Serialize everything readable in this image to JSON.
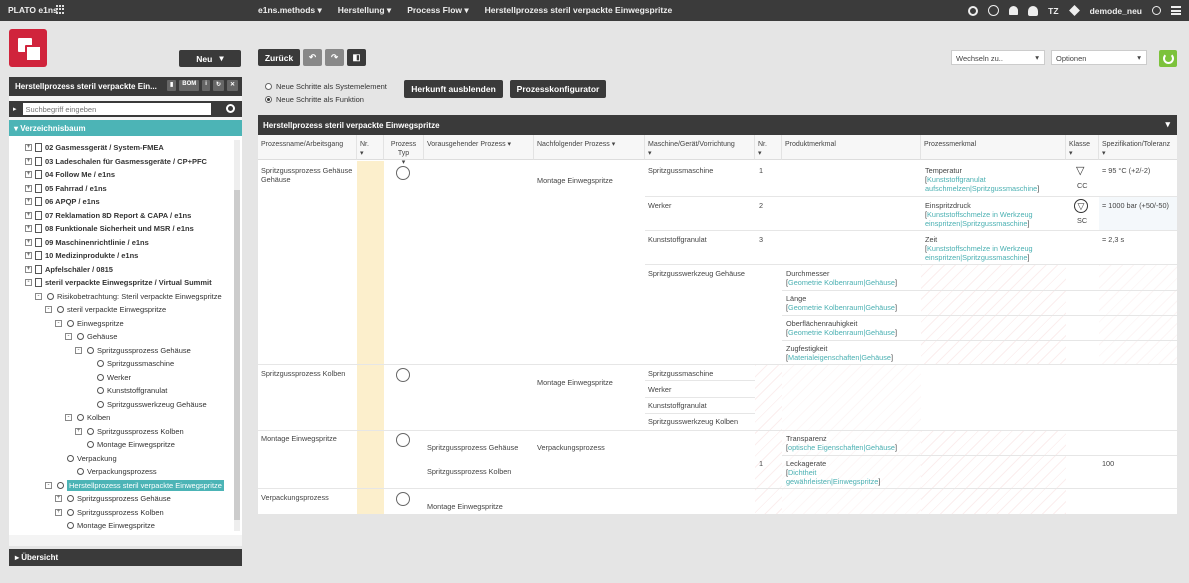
{
  "app": {
    "title": "PLATO e1ns"
  },
  "topnav": {
    "methods": "e1ns.methods",
    "herstellung": "Herstellung",
    "processflow": "Process Flow",
    "current": "Herstellprozess steril verpackte Einwegspritze",
    "user": "TZ",
    "workspace": "demode_neu"
  },
  "toolbar": {
    "neu": "Neu",
    "zurueck": "Zurück",
    "herkunft": "Herkunft ausblenden",
    "prozesskonfigurator": "Prozesskonfigurator",
    "wechseln": "Wechseln zu..",
    "optionen": "Optionen"
  },
  "radios": {
    "opt1": "Neue Schritte als Systemelement",
    "opt2": "Neue Schritte als Funktion"
  },
  "leftpanel": {
    "title": "Herstellprozess steril verpackte Ein...",
    "bom": "BOM",
    "search_placeholder": "Suchbegriff eingeben",
    "tree_title": "Verzeichnisbaum",
    "overview": "Übersicht"
  },
  "tree": [
    {
      "label": "02 Gasmessgerät / System-FMEA"
    },
    {
      "label": "03 Ladeschalen für Gasmessgeräte / CP+PFC"
    },
    {
      "label": "04 Follow Me / e1ns"
    },
    {
      "label": "05 Fahrrad / e1ns"
    },
    {
      "label": "06 APQP / e1ns"
    },
    {
      "label": "07 Reklamation 8D Report & CAPA / e1ns"
    },
    {
      "label": "08 Funktionale Sicherheit und MSR / e1ns"
    },
    {
      "label": "09 Maschinenrichtlinie / e1ns"
    },
    {
      "label": "10 Medizinprodukte / e1ns"
    },
    {
      "label": "Apfelschäler / 0815"
    },
    {
      "label": "steril verpackte Einwegspritze / Virtual Summit"
    },
    {
      "label": "Risikobetrachtung: Steril verpackte Einwegspritze"
    },
    {
      "label": "steril verpackte Einwegspritze"
    },
    {
      "label": "Einwegspritze"
    },
    {
      "label": "Gehäuse"
    },
    {
      "label": "Spritzgussprozess Gehäuse"
    },
    {
      "label": "Spritzgussmaschine"
    },
    {
      "label": "Werker"
    },
    {
      "label": "Kunststoffgranulat"
    },
    {
      "label": "Spritzgusswerkzeug Gehäuse"
    },
    {
      "label": "Kolben"
    },
    {
      "label": "Spritzgussprozess Kolben"
    },
    {
      "label": "Montage Einwegspritze"
    },
    {
      "label": "Verpackung"
    },
    {
      "label": "Verpackungsprozess"
    },
    {
      "label": "Herstellprozess steril verpackte Einwegspritze"
    },
    {
      "label": "Spritzgussprozess Gehäuse"
    },
    {
      "label": "Spritzgussprozess Kolben"
    },
    {
      "label": "Montage Einwegspritze"
    }
  ],
  "panel": {
    "title": "Herstellprozess steril verpackte Einwegspritze"
  },
  "columns": [
    "Prozessname/Arbeitsgang",
    "Nr.",
    "Prozess Typ",
    "Vorausgehender Prozess",
    "Nachfolgender Prozess",
    "Maschine/Gerät/Vorrichtung",
    "Nr.",
    "Produktmerkmal",
    "Prozessmerkmal",
    "Klasse",
    "Spezifikation/Toleranz"
  ],
  "table": {
    "p1": {
      "name": "Spritzgussprozess Gehäuse",
      "next": "Montage Einwegspritze"
    },
    "p2": {
      "name": "Spritzgussprozess Kolben",
      "next": "Montage Einwegspritze"
    },
    "p3": {
      "name": "Montage Einwegspritze",
      "prev1": "Spritzgussprozess Gehäuse",
      "prev2": "Spritzgussprozess Kolben",
      "next": "Verpackungsprozess"
    },
    "p4": {
      "name": "Verpackungsprozess",
      "prev": "Montage Einwegspritze"
    },
    "m1": "Spritzgussmaschine",
    "m2": "Werker",
    "m3": "Kunststoffgranulat",
    "m4": "Spritzgusswerkzeug Gehäuse",
    "m5": "Spritzgussmaschine",
    "m6": "Werker",
    "m7": "Kunststoffgranulat",
    "m8": "Spritzgusswerkzeug Kolben",
    "n1": "1",
    "n2": "2",
    "n3": "3",
    "n4": "1",
    "pm1": {
      "t": "Temperatur",
      "l1": "Kunststoffgranulat",
      "l2": "aufschmelzen|Spritzgussmaschine"
    },
    "pm2": {
      "t": "Einspritzdruck",
      "l1": "Kunststoffschmelze in Werkzeug",
      "l2": "einspritzen|Spritzgussmaschine"
    },
    "pm3": {
      "t": "Zeit",
      "l1": "Kunststoffschmelze in Werkzeug",
      "l2": "einspritzen|Spritzgussmaschine"
    },
    "k1": "CC",
    "k2": "SC",
    "s1": "= 95 °C (+2/-2)",
    "s2": "= 1000 bar (+50/-50)",
    "s3": "= 2,3 s",
    "s4": "100",
    "pr1": {
      "t": "Durchmesser",
      "l": "Geometrie Kolbenraum|Gehäuse"
    },
    "pr2": {
      "t": "Länge",
      "l": "Geometrie Kolbenraum|Gehäuse"
    },
    "pr3": {
      "t": "Oberflächenrauhigkeit",
      "l": "Geometrie Kolbenraum|Gehäuse"
    },
    "pr4": {
      "t": "Zugfestigkeit",
      "l": "Materialeigenschaften|Gehäuse"
    },
    "pr5": {
      "t": "Transparenz",
      "l": "optische Eigenschaften|Gehäuse"
    },
    "pr6": {
      "t": "Leckagerate",
      "l1": "Dichtheit",
      "l2": "gewährleisten|Einwegspritze"
    }
  }
}
